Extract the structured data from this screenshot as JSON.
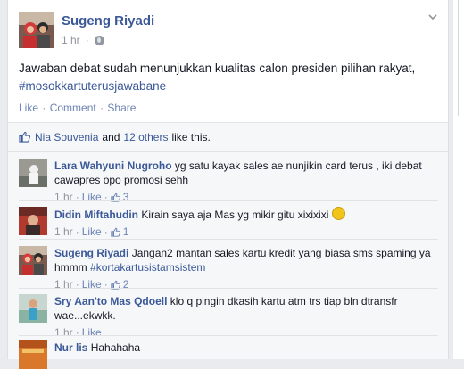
{
  "post": {
    "author": "Sugeng Riyadi",
    "time": "1 hr",
    "text": "Jawaban debat sudah menunjukkan kualitas calon presiden pilihan rakyat,",
    "hashtag": "#mosokkartuterusjawabane",
    "actions": {
      "like": "Like",
      "comment": "Comment",
      "share": "Share"
    }
  },
  "likes": {
    "first_liker": "Nia Souvenia",
    "connector": "and",
    "others": "12 others",
    "suffix": "like this."
  },
  "comments": [
    {
      "name": "Lara Wahyuni Nugroho",
      "text": "yg satu kayak sales ae nunjikin card terus , iki debat cawapres opo promosi sehh",
      "time": "1 hr",
      "like_label": "Like",
      "like_count": "3"
    },
    {
      "name": "Didin Miftahudin",
      "text": "Kirain saya aja Mas yg mikir gitu xixixixi",
      "time": "1 hr",
      "like_label": "Like",
      "like_count": "1"
    },
    {
      "name": "Sugeng Riyadi",
      "text": "Jangan2 mantan sales kartu kredit yang biasa sms spaming ya hmmm",
      "hashtag": "#kortakartusistamsistem",
      "time": "1 hr",
      "like_label": "Like",
      "like_count": "2"
    },
    {
      "name": "Sry Aan'to Mas Qdoell",
      "text": "klo q pingin dkasih kartu atm trs tiap bln dtransfr wae...ekwkk.",
      "time": "1 hr",
      "like_label": "Like"
    },
    {
      "name": "Nur lis",
      "text": "Hahahaha"
    }
  ],
  "colors": {
    "link": "#3b5998",
    "muted": "#90949c",
    "action": "#6d84b4",
    "comment_bg": "#f6f7f9"
  }
}
